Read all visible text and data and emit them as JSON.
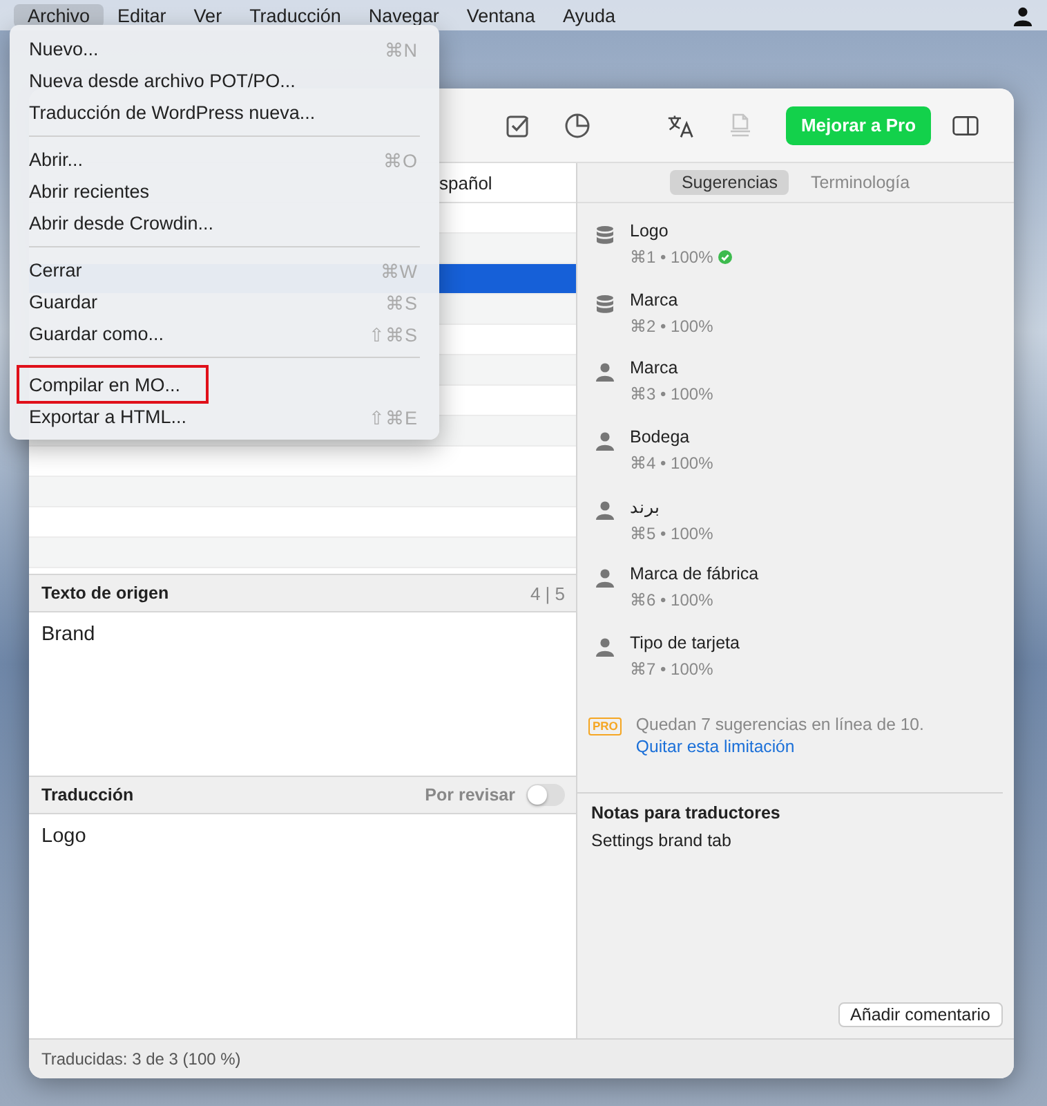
{
  "menubar": {
    "items": [
      {
        "label": "Archivo",
        "selected": true
      },
      {
        "label": "Editar",
        "selected": false
      },
      {
        "label": "Ver",
        "selected": false
      },
      {
        "label": "Traducción",
        "selected": false
      },
      {
        "label": "Navegar",
        "selected": false
      },
      {
        "label": "Ventana",
        "selected": false
      },
      {
        "label": "Ayuda",
        "selected": false
      }
    ]
  },
  "menu": {
    "groups": [
      [
        {
          "label": "Nuevo...",
          "shortcut": "⌘N",
          "highlighted": false
        },
        {
          "label": "Nueva desde archivo POT/PO...",
          "highlighted": false
        },
        {
          "label": "Traducción de WordPress nueva...",
          "highlighted": false
        }
      ],
      [
        {
          "label": "Abrir...",
          "shortcut": "⌘O",
          "highlighted": false
        },
        {
          "label": "Abrir recientes",
          "highlighted": false
        },
        {
          "label": "Abrir desde Crowdin...",
          "highlighted": false
        }
      ],
      [
        {
          "label": "Cerrar",
          "shortcut": "⌘W",
          "highlighted": false
        },
        {
          "label": "Guardar",
          "shortcut": "⌘S",
          "highlighted": false
        },
        {
          "label": "Guardar como...",
          "shortcut": "⇧⌘S",
          "highlighted": false
        }
      ],
      [
        {
          "label": "Compilar en MO...",
          "highlighted": true
        },
        {
          "label": "Exportar a HTML...",
          "shortcut": "⇧⌘E",
          "highlighted": false
        }
      ]
    ]
  },
  "toolbar": {
    "upgrade_button": "Mejorar a Pro"
  },
  "list": {
    "column_header": "spañol",
    "rows": [
      {
        "selected": false
      },
      {
        "selected": false
      },
      {
        "selected": true
      },
      {
        "selected": false
      },
      {
        "selected": false
      },
      {
        "selected": false
      },
      {
        "selected": false
      },
      {
        "selected": false
      },
      {
        "selected": false
      },
      {
        "selected": false
      },
      {
        "selected": false
      },
      {
        "selected": false
      }
    ]
  },
  "source": {
    "title": "Texto de origen",
    "counter": "4 | 5",
    "text": "Brand"
  },
  "translation": {
    "title": "Traducción",
    "review_label": "Por revisar",
    "review_on": false,
    "text": "Logo"
  },
  "status_bar": "Traducidas: 3 de 3 (100 %)",
  "sidebar": {
    "tabs": [
      {
        "label": "Sugerencias",
        "selected": true
      },
      {
        "label": "Terminología",
        "selected": false
      }
    ],
    "suggestions": [
      {
        "kind": "database",
        "text": "Logo",
        "meta": "⌘1 • 100%",
        "verified": true
      },
      {
        "kind": "database",
        "text": "Marca",
        "meta": "⌘2 • 100%",
        "verified": false
      },
      {
        "kind": "user",
        "text": "Marca",
        "meta": "⌘3 • 100%",
        "verified": false
      },
      {
        "kind": "user",
        "text": "Bodega",
        "meta": "⌘4 • 100%",
        "verified": false
      },
      {
        "kind": "user",
        "text": "برند",
        "meta": "⌘5 • 100%",
        "verified": false
      },
      {
        "kind": "user",
        "text": "Marca de fábrica",
        "meta": "⌘6 • 100%",
        "verified": false
      },
      {
        "kind": "user",
        "text": "Tipo de tarjeta",
        "meta": "⌘7 • 100%",
        "verified": false
      }
    ],
    "pro_badge": "PRO",
    "pro_note": "Quedan 7 sugerencias en línea de 10.",
    "pro_link": "Quitar esta limitación",
    "notes_title": "Notas para traductores",
    "notes_text": "Settings brand tab",
    "comment_button": "Añadir comentario"
  }
}
